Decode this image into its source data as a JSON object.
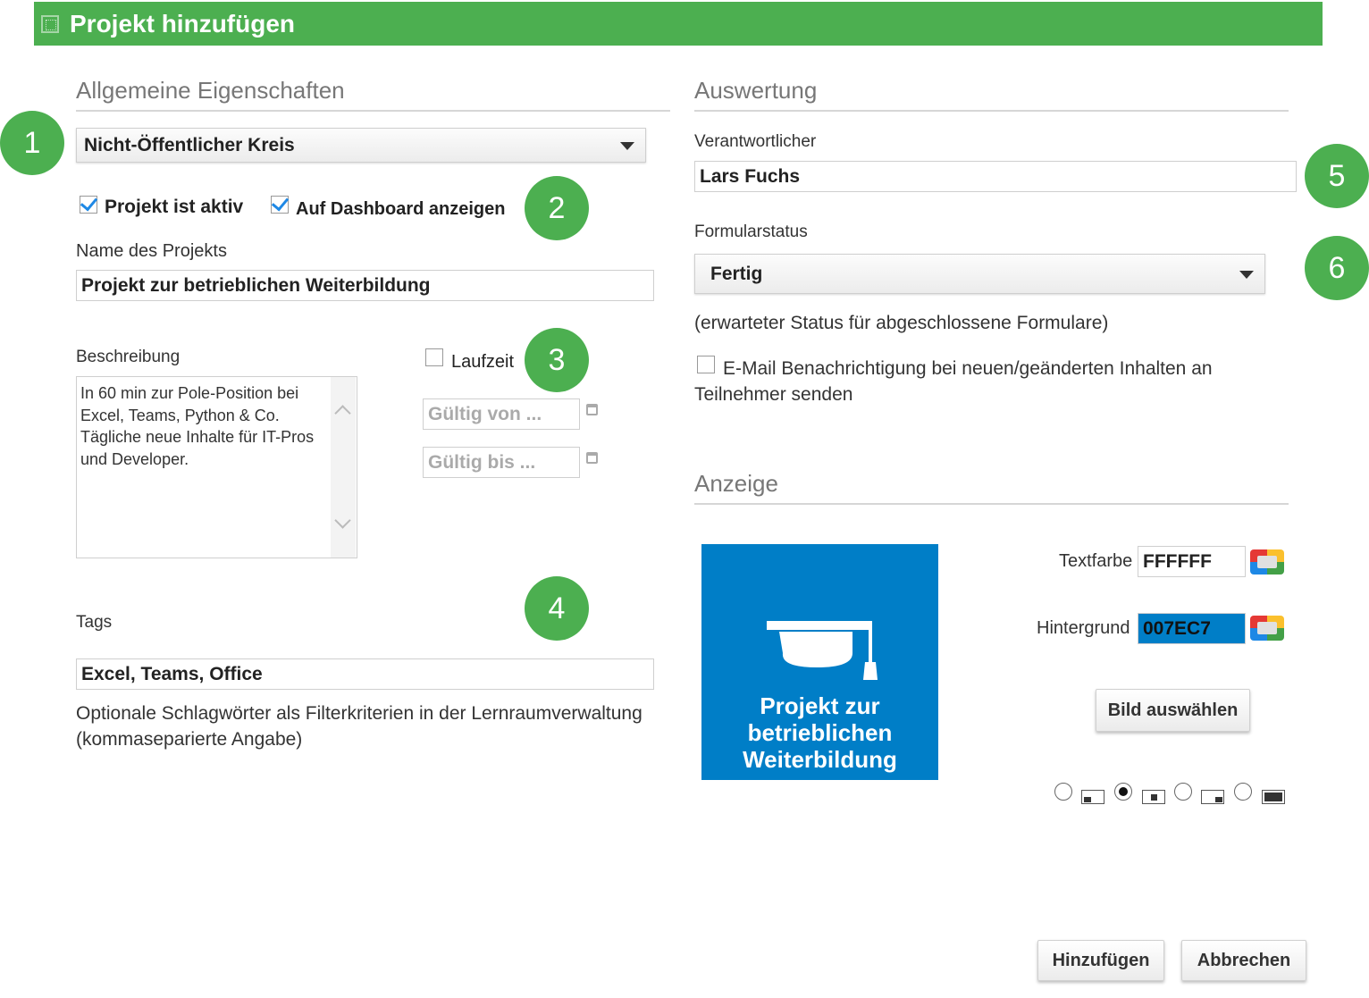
{
  "dialog": {
    "title": "Projekt hinzufügen"
  },
  "general": {
    "heading": "Allgemeine Eigenschaften",
    "circle_select": "Nicht-Öffentlicher Kreis",
    "active_label": "Projekt ist aktiv",
    "active_checked": true,
    "dashboard_label": "Auf Dashboard anzeigen",
    "dashboard_checked": true,
    "name_label": "Name des Projekts",
    "name_value": "Projekt zur betrieblichen Weiterbildung",
    "description_label": "Beschreibung",
    "description_value": "In 60 min zur Pole-Position bei\nExcel, Teams, Python & Co.\nTägliche neue Inhalte für IT-Pros\nund Developer.",
    "runtime_label": "Laufzeit",
    "runtime_checked": false,
    "valid_from_placeholder": "Gültig von ...",
    "valid_to_placeholder": "Gültig bis ...",
    "tags_label": "Tags",
    "tags_value": "Excel, Teams, Office",
    "tags_note": "Optionale Schlagwörter als Filterkriterien in der Lernraumverwaltung\n(kommaseparierte Angabe)"
  },
  "evaluation": {
    "heading": "Auswertung",
    "responsible_label": "Verantwortlicher",
    "responsible_value": "Lars Fuchs",
    "form_status_label": "Formularstatus",
    "form_status_value": "Fertig",
    "form_status_note": "(erwarteter Status für abgeschlossene Formulare)",
    "email_label": "E-Mail Benachrichtigung bei neuen/geänderten Inhalten an\nTeilnehmer senden",
    "email_checked": false
  },
  "display": {
    "heading": "Anzeige",
    "preview_title": "Projekt zur\nbetrieblichen\nWeiterbildung",
    "text_color_label": "Textfarbe",
    "text_color_value": "FFFFFF",
    "background_label": "Hintergrund",
    "background_value": "007EC7",
    "choose_image_button": "Bild auswählen",
    "image_position_selected": 1
  },
  "badges": [
    "1",
    "2",
    "3",
    "4",
    "5",
    "6"
  ],
  "footer": {
    "add_button": "Hinzufügen",
    "cancel_button": "Abbrechen"
  },
  "colors": {
    "title_bar": "#4caf50",
    "badge": "#4caf50",
    "preview_bg": "#007ec7",
    "background_field_bg": "#007ec7",
    "checkbox_check": "#1e88e5"
  }
}
